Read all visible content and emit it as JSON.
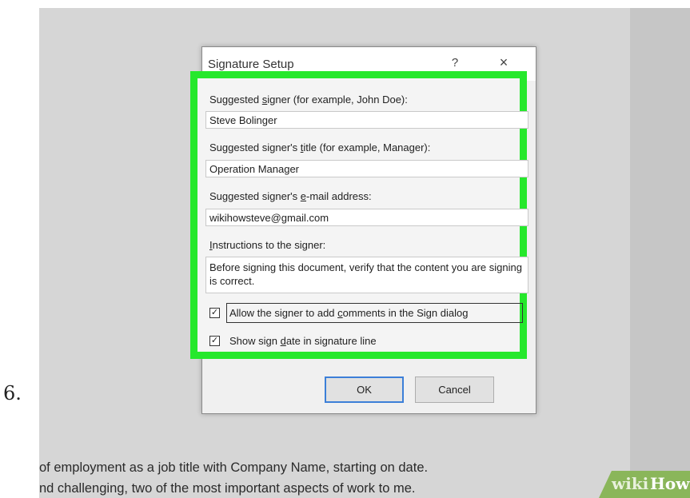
{
  "step_number": "6.",
  "dialog": {
    "title": "Signature Setup",
    "help_symbol": "?",
    "close_symbol": "×",
    "signer_label_pre": "Suggested ",
    "signer_label_u": "s",
    "signer_label_post": "igner (for example, John Doe):",
    "signer_value": "Steve Bolinger",
    "title_label_pre": "Suggested signer's ",
    "title_label_u": "t",
    "title_label_post": "itle (for example, Manager):",
    "title_value": "Operation Manager",
    "email_label_pre": "Suggested signer's ",
    "email_label_u": "e",
    "email_label_post": "-mail address:",
    "email_value": "wikihowsteve@gmail.com",
    "instructions_label_u": "I",
    "instructions_label_post": "nstructions to the signer:",
    "instructions_value": "Before signing this document, verify that the content you are signing is correct.",
    "allow_comments_pre": "Allow the signer to add ",
    "allow_comments_u": "c",
    "allow_comments_post": "omments in the Sign dialog",
    "allow_comments_checked": true,
    "show_date_pre": "Show sign ",
    "show_date_u": "d",
    "show_date_post": "ate in signature line",
    "show_date_checked": true,
    "ok_label": "OK",
    "cancel_label": "Cancel"
  },
  "document": {
    "line1": "of employment as a job title with Company Name, starting on date.",
    "line2": "nd challenging, two of the most important aspects of work to me."
  },
  "watermark": {
    "wiki": "wiki",
    "how": "How"
  },
  "colors": {
    "highlight": "#26e82c",
    "watermark_bg": "#8ab65a",
    "ok_border": "#3c7fd8"
  }
}
